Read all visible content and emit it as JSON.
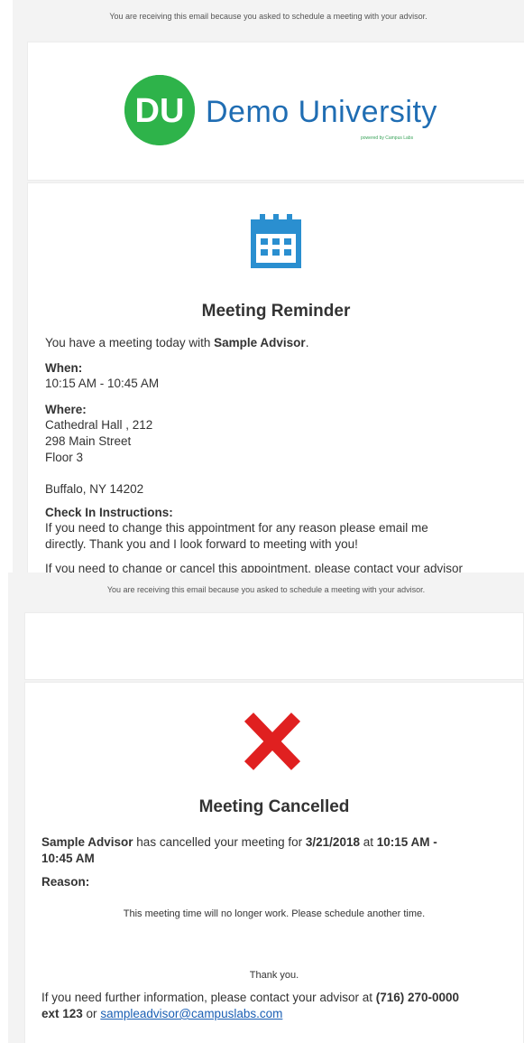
{
  "reminder": {
    "notice": "You are receiving this email because you asked to schedule a meeting with your advisor.",
    "logo": {
      "initials": "DU",
      "name": "Demo University",
      "powered_by": "powered by Campus Labs",
      "brand_green": "#2eb34a",
      "brand_blue": "#1f6db3"
    },
    "icon": "calendar-icon",
    "icon_color": "#2a8fd0",
    "title": "Meeting Reminder",
    "intro_prefix": "You have a meeting today with ",
    "advisor": "Sample Advisor",
    "intro_suffix": ".",
    "when_label": "When:",
    "when_value": "10:15 AM - 10:45 AM",
    "where_label": "Where:",
    "where_lines": [
      "Cathedral Hall , 212",
      "298 Main Street",
      "Floor 3"
    ],
    "city_line": "Buffalo, NY 14202",
    "checkin_label": "Check In Instructions:",
    "checkin_lines": [
      "If you need to change this appointment for any reason please email me",
      "directly. Thank you and I look forward to meeting with you!"
    ],
    "cut_line": "If you need to change or cancel this appointment, please contact your advisor"
  },
  "cancellation": {
    "notice": "You are receiving this email because you asked to schedule a meeting with your advisor.",
    "icon": "x-icon",
    "icon_color": "#e02020",
    "title": "Meeting Cancelled",
    "advisor": "Sample Advisor",
    "cancel_text": " has cancelled your meeting for ",
    "date": "3/21/2018",
    "at_text": " at ",
    "time_part1": "10:15 AM -",
    "time_part2": "10:45 AM",
    "reason_label": "Reason:",
    "reason_text": "This meeting time will no longer work.  Please schedule another time.",
    "thanks": "Thank you.",
    "contact_prefix": "If you need further information, please contact your advisor at ",
    "phone": "(716) 270-0000",
    "ext": "ext 123",
    "or_text": " or ",
    "email": "sampleadvisor@campuslabs.com"
  }
}
